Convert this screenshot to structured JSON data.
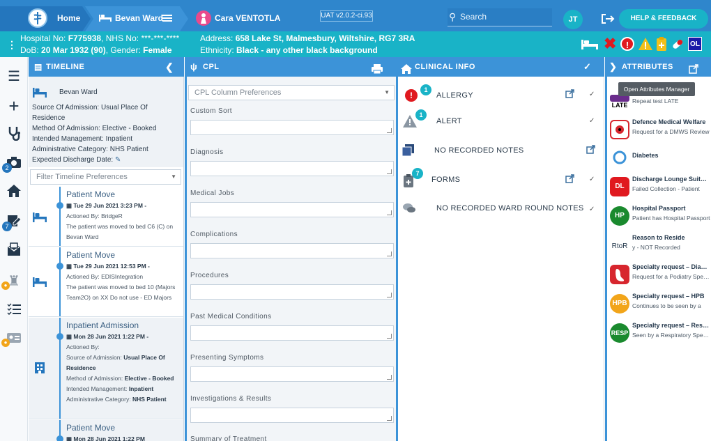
{
  "topbar": {
    "home": "Home",
    "ward": "Bevan Ward",
    "patient": "Cara VENTOTLA",
    "version": "UAT v2.0.2-ci.93",
    "search": "Search",
    "initials": "JT",
    "help": "HELP & FEEDBACK"
  },
  "patient": {
    "hospital_no_label": "Hospital No:",
    "hospital_no": "F775938",
    "nhs_label": ", NHS No:",
    "nhs_no": "***-***-****",
    "dob_label": "DoB:",
    "dob": "20 Mar 1932 (90)",
    "gender_label": ", Gender:",
    "gender": "Female",
    "address_label": "Address:",
    "address": "658 Lake St, Malmesbury, Wiltshire, RG7 3RA",
    "ethnicity_label": "Ethnicity:",
    "ethnicity": "Black - any other black background",
    "header_initials": "OL"
  },
  "nav": {
    "badge_record": "2",
    "badge_tasks": "7"
  },
  "panels": {
    "timeline": "TIMELINE",
    "cpl": "CPL",
    "clinical": "CLINICAL INFO",
    "attributes": "ATTRIBUTES"
  },
  "timeline": {
    "ward": "Bevan Ward",
    "admission": [
      {
        "label": "Source Of Admission:",
        "value": "Usual Place Of Residence"
      },
      {
        "label": "Method Of Admission:",
        "value": "Elective - Booked"
      },
      {
        "label": "Intended Management:",
        "value": "Inpatient"
      },
      {
        "label": "Administrative Category:",
        "value": "NHS Patient"
      }
    ],
    "discharge_label": "Expected Discharge Date:",
    "filter_placeholder": "Filter Timeline Preferences",
    "events": [
      {
        "title": "Patient Move",
        "date": "Tue 29 Jun 2021 3:23 PM -",
        "actioned": "Actioned By: BridgeR",
        "detail": "The patient was moved to bed C6 (C) on Bevan Ward"
      },
      {
        "title": "Patient Move",
        "date": "Tue 29 Jun 2021 12:53 PM -",
        "actioned": "Actioned By: EDISIntegration",
        "detail": "The patient was moved to bed 10 (Majors Team2O) on XX Do not use - ED Majors"
      },
      {
        "title": "Inpatient Admission",
        "date": "Mon 28 Jun 2021 1:22 PM -",
        "actioned": "Actioned By:",
        "f1l": "Source of Admission:",
        "f1v": "Usual Place Of Residence",
        "f2l": "Method of Admission:",
        "f2v": "Elective - Booked",
        "f3l": "Intended Management:",
        "f3v": "Inpatient",
        "f4l": "Administrative Category:",
        "f4v": "NHS Patient"
      },
      {
        "title": "Patient Move",
        "date": "Mon 28 Jun 2021 1:22 PM"
      }
    ]
  },
  "cpl": {
    "preferences_placeholder": "CPL Column Preferences",
    "fields": [
      "Custom Sort",
      "Diagnosis",
      "Medical Jobs",
      "Complications",
      "Procedures",
      "Past Medical Conditions",
      "Presenting Symptoms",
      "Investigations & Results",
      "Summary of Treatment"
    ]
  },
  "clinical": [
    {
      "label": "ALLERGY",
      "badge": "1"
    },
    {
      "label": "ALERT",
      "badge": "1"
    },
    {
      "label": "NO RECORDED NOTES"
    },
    {
      "label": "FORMS",
      "badge": "7"
    },
    {
      "label": "NO RECORDED WARD ROUND NOTES"
    }
  ],
  "attributes": {
    "tooltip": "Open Attributes Manager",
    "items": [
      {
        "icon": "LATE",
        "title": "",
        "sub": "Repeat test LATE",
        "color": "#6a2c8c"
      },
      {
        "icon": "",
        "title": "Defence Medical Welfare",
        "sub": "Request for a DMWS Review",
        "color": "#d7262e"
      },
      {
        "icon": "",
        "title": "Diabetes",
        "sub": "",
        "color": "#3c93d8"
      },
      {
        "icon": "DL",
        "title": "Discharge Lounge Suitability",
        "sub": "Failed Collection - Patient",
        "color": "#e0191f"
      },
      {
        "icon": "HP",
        "title": "Hospital Passport",
        "sub": "Patient has Hospital Passport",
        "color": "#1a8a2e"
      },
      {
        "icon": "RtoR",
        "title": "Reason to Reside",
        "sub": "y - NOT Recorded",
        "color": "#ffffff"
      },
      {
        "icon": "",
        "title": "Specialty request – Diabetes",
        "sub": "Request for a Podiatry Specialist",
        "color": "#d7262e"
      },
      {
        "icon": "HPB",
        "title": "Specialty request – HPB",
        "sub": "Continues to be seen by a",
        "color": "#f2a51a"
      },
      {
        "icon": "RESP",
        "title": "Specialty request – Respiratory",
        "sub": "Seen by a Respiratory Specialist",
        "color": "#1a8a2e"
      }
    ]
  },
  "colors": {
    "primary": "#2f86cc",
    "accent": "#19b3c7",
    "panel": "#3c93d8"
  }
}
